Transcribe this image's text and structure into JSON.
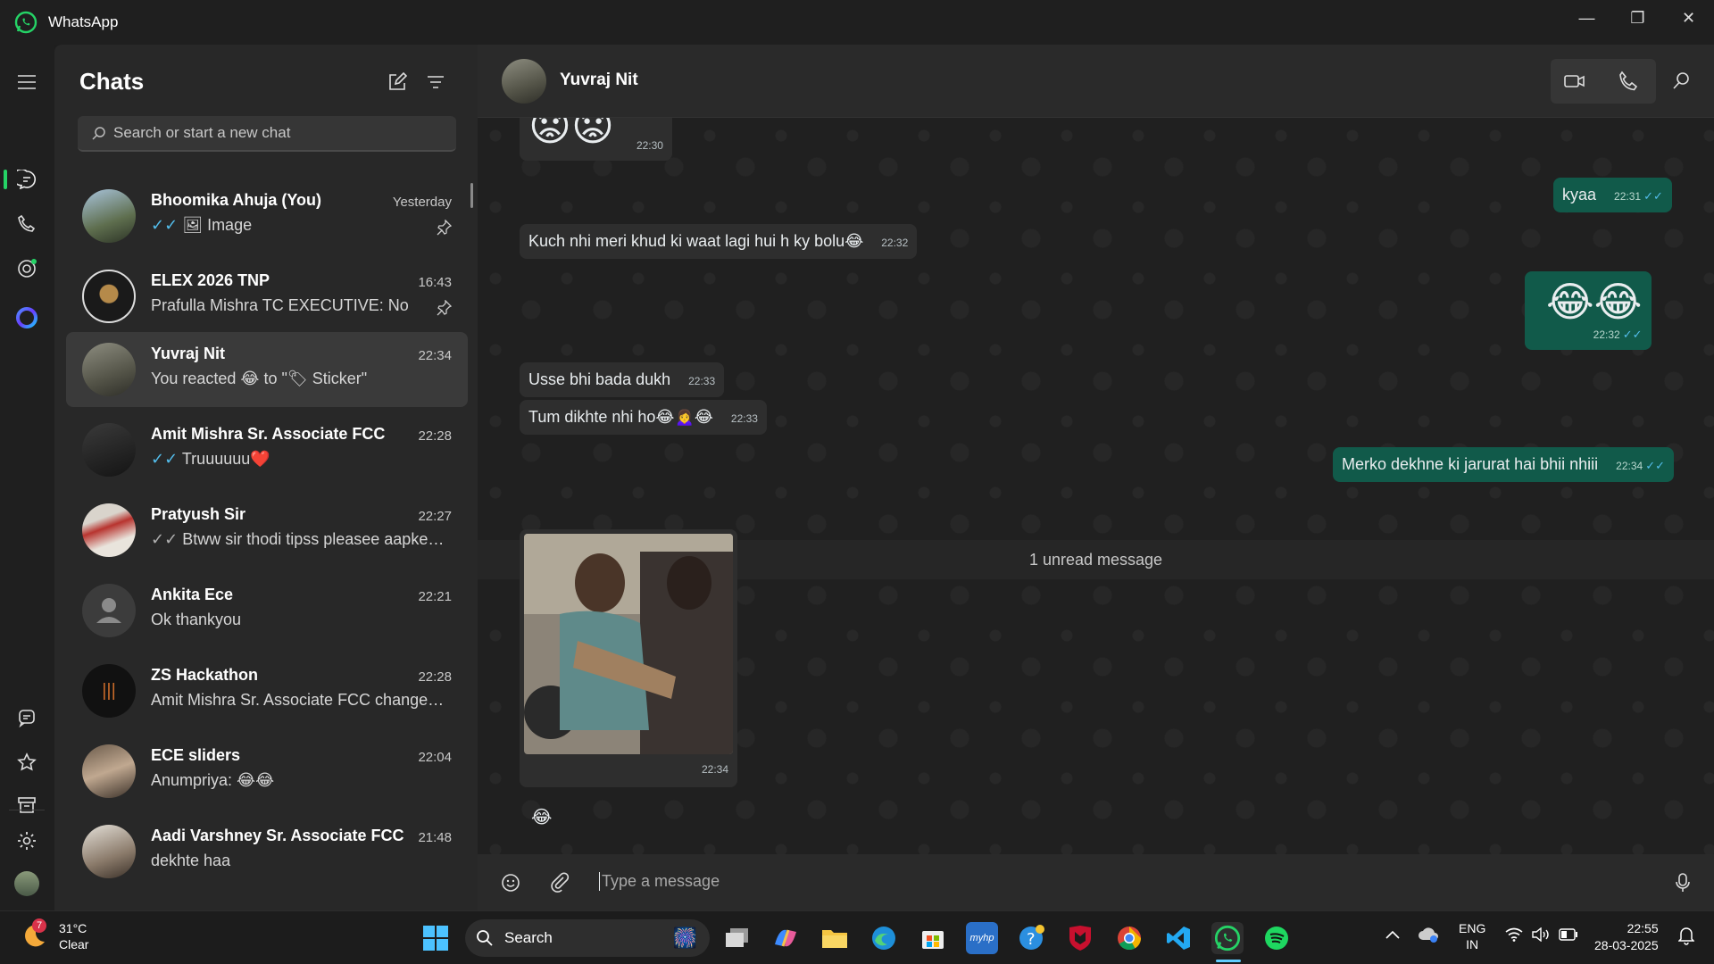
{
  "window": {
    "title": "WhatsApp",
    "minimize": "—",
    "restore": "❐",
    "close": "✕"
  },
  "chatlist": {
    "header": "Chats",
    "search_placeholder": "Search or start a new chat",
    "items": [
      {
        "name": "Bhoomika Ahuja (You)",
        "time": "Yesterday",
        "tick": "✓✓",
        "preview": "Image",
        "pinned": true
      },
      {
        "name": "ELEX 2026 TNP",
        "time": "16:43",
        "preview": "Prafulla Mishra TC EXECUTIVE: No",
        "pinned": true
      },
      {
        "name": "Yuvraj Nit",
        "time": "22:34",
        "preview": "You reacted 😂 to \"🏷 Sticker\""
      },
      {
        "name": "Amit Mishra Sr. Associate FCC",
        "time": "22:28",
        "tick": "✓✓",
        "preview": "Truuuuuu❤️"
      },
      {
        "name": "Pratyush Sir",
        "time": "22:27",
        "tick": "✓✓",
        "preview": "Btww sir thodi tipss pleasee aapke j..."
      },
      {
        "name": "Ankita Ece",
        "time": "22:21",
        "preview": "Ok thankyou"
      },
      {
        "name": "ZS Hackathon",
        "time": "22:28",
        "preview": "Amit Mishra Sr. Associate FCC changed..."
      },
      {
        "name": "ECE sliders",
        "time": "22:04",
        "preview": "Anumpriya: 😂😂"
      },
      {
        "name": "Aadi Varshney Sr. Associate FCC",
        "time": "21:48",
        "preview": "dekhte haa"
      }
    ]
  },
  "conversation": {
    "contact": "Yuvraj Nit",
    "messages": [
      {
        "dir": "in",
        "text": "😟😟",
        "time": "22:30"
      },
      {
        "dir": "out",
        "text": "kyaa",
        "time": "22:31",
        "tick": "✓✓"
      },
      {
        "dir": "in",
        "text": "Kuch nhi meri khud ki waat lagi hui h ky bolu😂",
        "time": "22:32"
      },
      {
        "dir": "out",
        "text": "😂😂",
        "time": "22:32",
        "tick": "✓✓"
      },
      {
        "dir": "in",
        "text": "Usse bhi bada dukh",
        "time": "22:33"
      },
      {
        "dir": "in",
        "text": "Tum dikhte nhi ho😂🙍‍♀️😂",
        "time": "22:33"
      },
      {
        "dir": "out",
        "text": "Merko dekhne ki jarurat hai bhii nhiii",
        "time": "22:34",
        "tick": "✓✓"
      }
    ],
    "unread_label": "1 unread message",
    "image_message": {
      "time": "22:34",
      "reaction": "😂"
    },
    "composer_placeholder": "Type a message"
  },
  "taskbar": {
    "weather_temp": "31°C",
    "weather_desc": "Clear",
    "weather_badge": "7",
    "search_label": "Search",
    "lang_top": "ENG",
    "lang_bottom": "IN",
    "time": "22:55",
    "date": "28-03-2025"
  },
  "colors": {
    "accent": "#25d366",
    "outgoing": "#115a4a",
    "incoming": "#2e2e2e",
    "read_tick": "#53bdeb"
  }
}
